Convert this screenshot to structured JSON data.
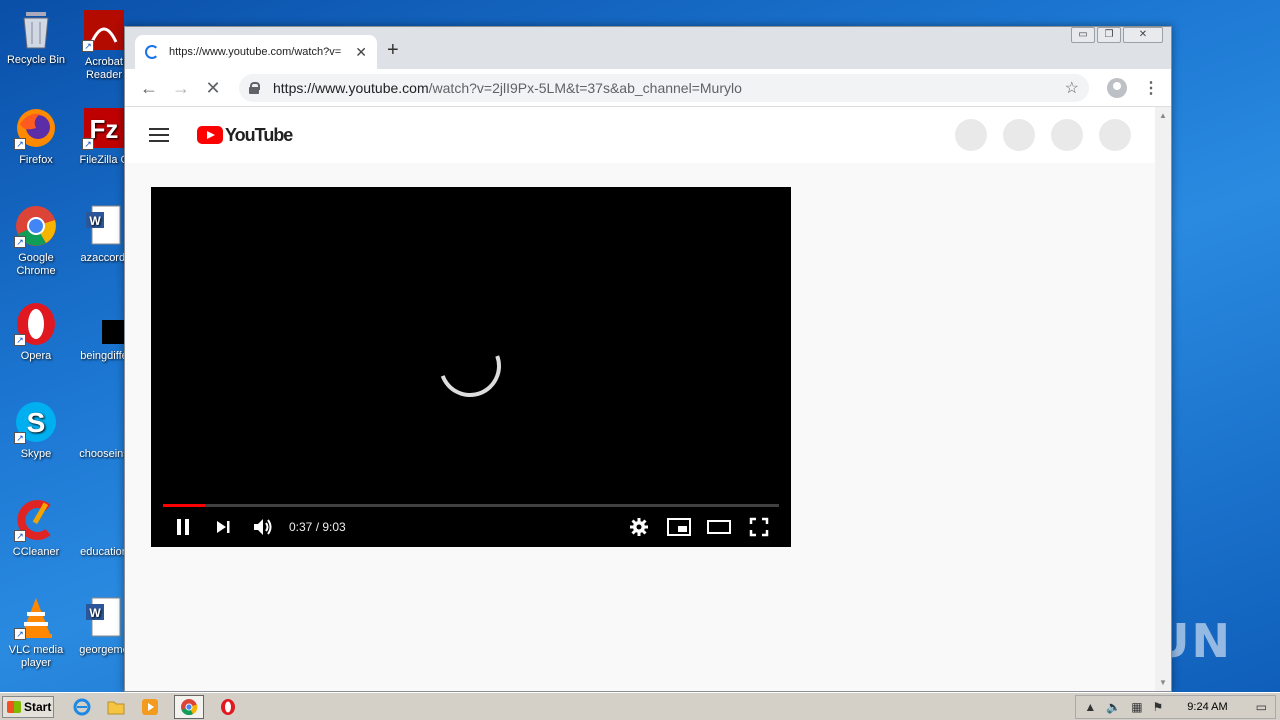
{
  "desktop": {
    "icons_col1": [
      {
        "label": "Recycle Bin"
      },
      {
        "label": "Firefox"
      },
      {
        "label": "Google Chrome"
      },
      {
        "label": "Opera"
      },
      {
        "label": "Skype"
      },
      {
        "label": "CCleaner"
      },
      {
        "label": "VLC media player"
      }
    ],
    "icons_col2": [
      {
        "label": "Acrobat Reader"
      },
      {
        "label": "FileZilla C"
      },
      {
        "label": "azaccordi"
      },
      {
        "label": "beingdiffe"
      },
      {
        "label": "chooseins"
      },
      {
        "label": "education"
      },
      {
        "label": "georgeme"
      }
    ],
    "watermark": "ANY RUN"
  },
  "browser": {
    "tab_title": "https://www.youtube.com/watch?v=",
    "url_host": "https://www.youtube.com",
    "url_path": "/watch?v=2jlI9Px-5LM&t=37s&ab_channel=Murylo",
    "window_buttons": {
      "minimize": "▭",
      "restore": "❐",
      "close": "✕"
    }
  },
  "youtube": {
    "logo_text": "YouTube",
    "player": {
      "time_display": "0:37 / 9:03",
      "progress_fraction": 0.068
    }
  },
  "taskbar": {
    "start_label": "Start",
    "clock": "9:24 AM"
  }
}
